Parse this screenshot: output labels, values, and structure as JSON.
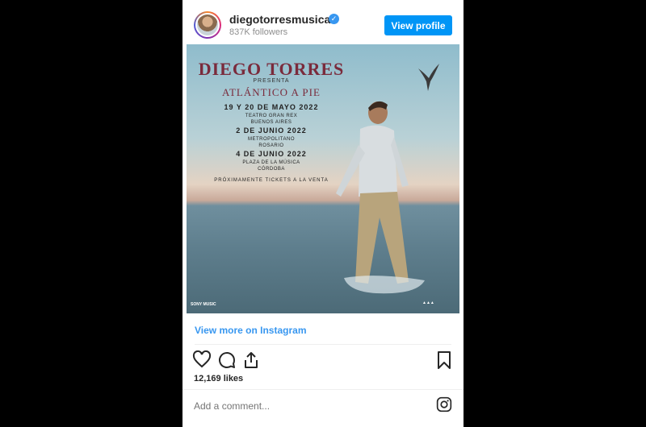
{
  "header": {
    "username": "diegotorresmusica",
    "verified_icon": "verified-badge-icon",
    "followers": "837K followers",
    "view_profile_label": "View profile"
  },
  "poster": {
    "artist": "DIEGO TORRES",
    "presenta": "PRESENTA",
    "album": "ATLÁNTICO A PIE",
    "date1": "19 Y 20 DE MAYO 2022",
    "venue1_line1": "TEATRO GRAN REX",
    "venue1_line2": "BUENOS AIRES",
    "date2": "2 DE JUNIO 2022",
    "venue2_line1": "METROPOLITANO",
    "venue2_line2": "ROSARIO",
    "date3": "4 DE JUNIO 2022",
    "venue3_line1": "PLAZA DE LA MÚSICA",
    "venue3_line2": "CÓRDOBA",
    "tickets": "PRÓXIMAMENTE TICKETS A LA VENTA",
    "label_left": "SONY MUSIC"
  },
  "post": {
    "view_more": "View more on Instagram",
    "likes": "12,169 likes",
    "comment_placeholder": "Add a comment..."
  },
  "icons": [
    "heart-icon",
    "comment-icon",
    "share-icon",
    "bookmark-icon",
    "instagram-icon"
  ]
}
